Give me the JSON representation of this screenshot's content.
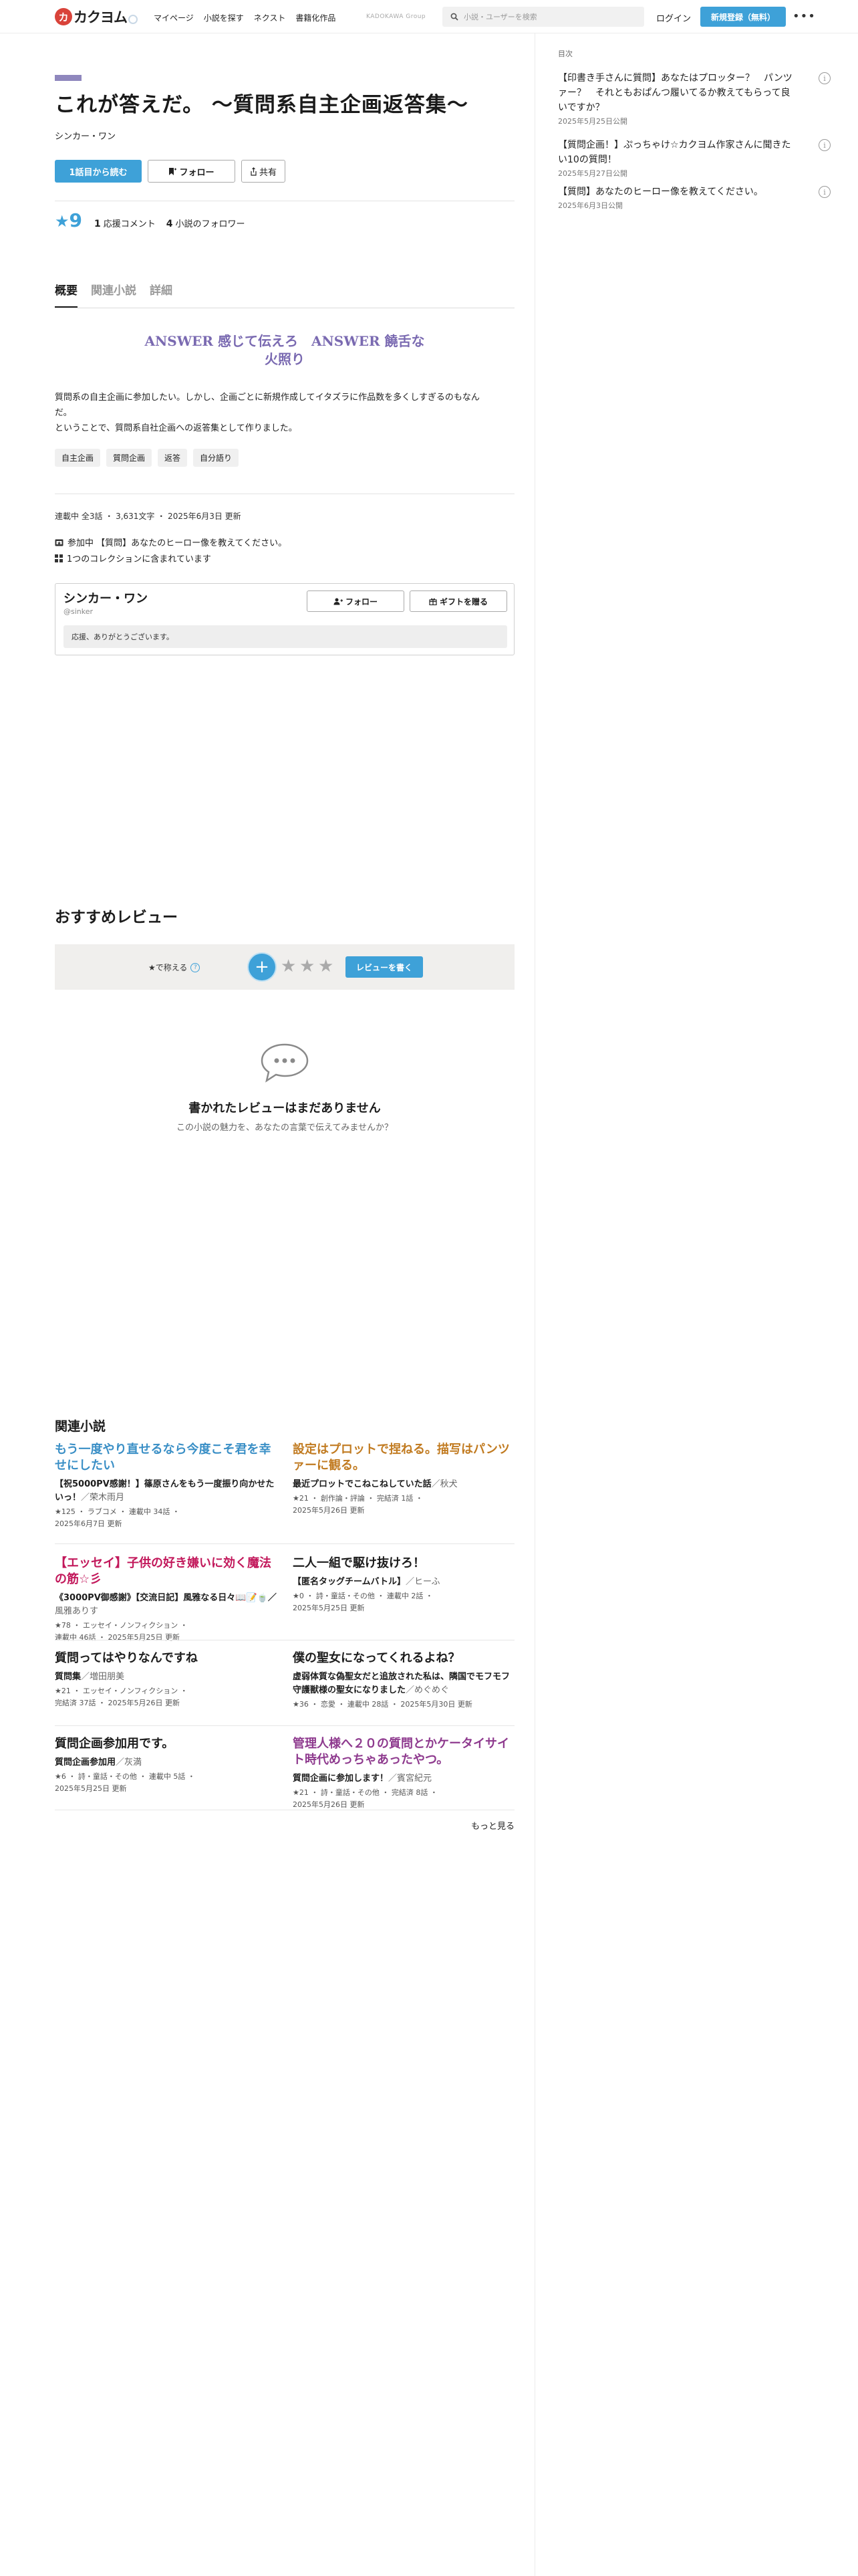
{
  "header": {
    "logo_mark": "カ",
    "logo_text": "カクヨム",
    "nav": [
      "マイページ",
      "小説を探す",
      "ネクスト",
      "書籍化作品"
    ],
    "group_label": "KADOKAWA Group",
    "search_placeholder": "小説・ユーザーを検索",
    "login": "ログイン",
    "signup": "新規登録（無料）",
    "more": "•••"
  },
  "toc": {
    "label": "目次",
    "items": [
      {
        "title": "【印書き手さんに質問】あなたはプロッター？　パンツァー？　それともおぱんつ履いてるか教えてもらって良いですか？",
        "date": "2025年5月25日公開"
      },
      {
        "title": "【質問企画！】ぷっちゃけ☆カクヨム作家さんに聞きたい10の質問！",
        "date": "2025年5月27日公開"
      },
      {
        "title": "【質問】あなたのヒーロー像を教えてください。",
        "date": "2025年6月3日公開"
      }
    ]
  },
  "work": {
    "title": "これが答えだ。 〜質問系自主企画返答集〜",
    "author": "シンカー・ワン",
    "genre_color": "#8f87bd",
    "read_button": "1話目から読む",
    "follow_button": "フォロー",
    "share_button": "共有",
    "stars": "9",
    "star_symbol": "★",
    "comments_count": "1",
    "comments_label": "応援コメント",
    "followers_count": "4",
    "followers_label": "小説のフォロワー"
  },
  "tabs": [
    "概要",
    "関連小説",
    "詳細"
  ],
  "catch": {
    "line1": "ANSWER 感じて伝えろ　ANSWER 饒舌な",
    "line2": "火照り"
  },
  "intro": {
    "line1": "質問系の自主企画に参加したい。しかし、企画ごとに新規作成してイタズラに作品数を多くしすぎるのもなん",
    "line2": "だ。",
    "line3": "ということで、質問系自社企画への返答集として作りました。"
  },
  "tags": [
    "自主企画",
    "質問企画",
    "返答",
    "自分語り"
  ],
  "meta": {
    "status": "連載中 全3話 ・ 3,631文字 ・ 2025年6月3日 更新",
    "event": "参加中 【質問】あなたのヒーロー像を教えてください。",
    "collections": "1つのコレクションに含まれています"
  },
  "author_card": {
    "name": "シンカー・ワン",
    "handle": "@sinker",
    "follow": "フォロー",
    "gift": "ギフトを贈る",
    "message": "応援、ありがとうございます。"
  },
  "reviews": {
    "heading": "おすすめレビュー",
    "rate_label": "★で称える",
    "q_mark": "?",
    "plus": "+",
    "star": "★",
    "write": "レビューを書く",
    "empty_title": "書かれたレビューはまだありません",
    "empty_sub": "この小説の魅力を、あなたの言葉で伝えてみませんか？"
  },
  "related": {
    "heading": "関連小説",
    "more": "もっと見る",
    "items": [
      {
        "title": "もう一度やり直せるなら今度こそ君を幸せにしたい",
        "color": "#3a8fc6",
        "sub": "【祝5000PV感謝！】篠原さんをもう一度振り向かせたいっ！",
        "author": "／荣木雨月",
        "meta1": "★125 ・ ラブコメ ・ 連載中 34話 ・",
        "meta2": "2025年6月7日 更新"
      },
      {
        "title": "設定はプロットで捏ねる。描写はパンツァーに観る。",
        "color": "#c17b21",
        "sub": "最近プロットでこねこねしていた話",
        "author": "／秋犬",
        "meta1": "★21 ・ 創作論・評論 ・ 完結済 1話 ・",
        "meta2": "2025年5月26日 更新"
      },
      {
        "title": "【エッセイ】子供の好き嫌いに効く魔法の筋☆彡",
        "color": "#c2185b",
        "sub": "《3000PV御感謝》【交流日記】風雅なる日々📖📝🍵／",
        "author": "風雅ありす",
        "meta1": "★78 ・ エッセイ・ノンフィクション ・",
        "meta2": "連載中 46話 ・ 2025年5月25日 更新"
      },
      {
        "title": "二人一組で駆け抜けろ！",
        "color": "#1c1c1c",
        "sub": "【匿名タッグチームバトル】",
        "author": "／ヒーふ",
        "meta1": "★0 ・ 詩・童話・その他 ・ 連載中 2話 ・",
        "meta2": "2025年5月25日 更新"
      },
      {
        "title": "質問ってはやりなんですね",
        "color": "#1c1c1c",
        "sub": "質問集",
        "author": "／増田朋美",
        "meta1": "★21 ・ エッセイ・ノンフィクション ・",
        "meta2": "完結済 37話 ・ 2025年5月26日 更新"
      },
      {
        "title": "僕の聖女になってくれるよね？",
        "color": "#1c1c1c",
        "sub": "虚弱体質な偽聖女だと追放された私は、隣国でモフモフ守護獣様の聖女になりました",
        "author": "／めぐめぐ",
        "meta1": "★36 ・ 恋愛 ・ 連載中 28話 ・ 2025年5月30日 更新",
        "meta2": ""
      },
      {
        "title": "質問企画参加用です。",
        "color": "#1c1c1c",
        "sub": "質問企画参加用",
        "author": "／灰満",
        "meta1": "★6 ・ 詩・童話・その他 ・ 連載中 5話 ・",
        "meta2": "2025年5月25日 更新"
      },
      {
        "title": "管理人様へ２０の質問とかケータイサイト時代めっちゃあったやつ。",
        "color": "#8e3a8e",
        "sub": "質問企画に参加します！",
        "author": "／賓宮紀元",
        "meta1": "★21 ・ 詩・童話・その他 ・ 完結済 8話 ・",
        "meta2": "2025年5月26日 更新"
      }
    ]
  }
}
